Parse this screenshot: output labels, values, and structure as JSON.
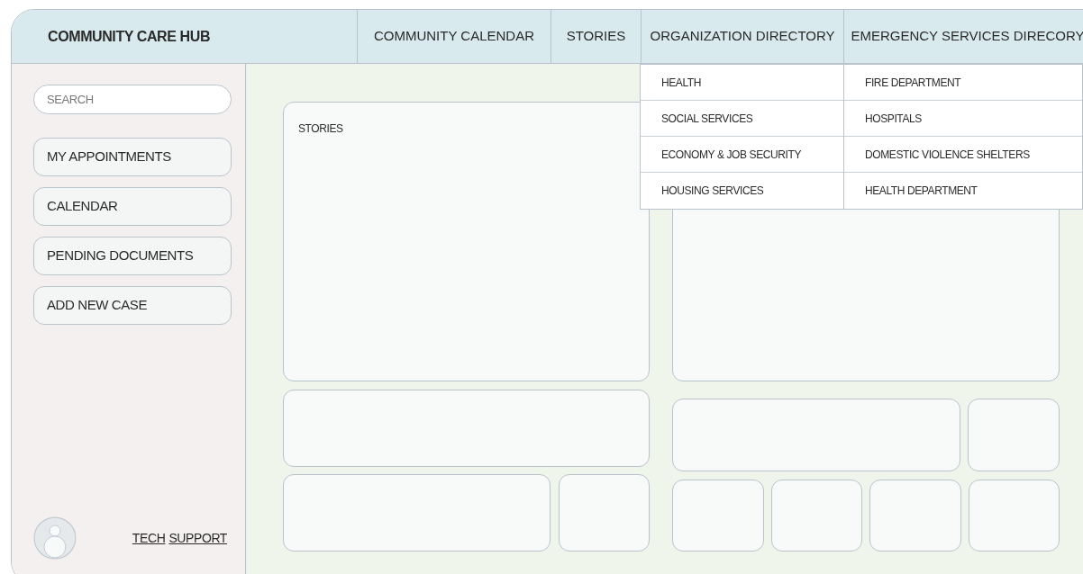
{
  "brand": "COMMUNITY CARE HUB",
  "nav": [
    {
      "label": "COMMUNITY CALENDAR"
    },
    {
      "label": "STORIES"
    },
    {
      "label": "ORGANIZATION DIRECTORY",
      "menu": [
        "HEALTH",
        "SOCIAL SERVICES",
        "ECONOMY & JOB SECURITY",
        "HOUSING SERVICES"
      ]
    },
    {
      "label": "EMERGENCY SERVICES DIRECORY",
      "menu": [
        "FIRE DEPARTMENT",
        "HOSPITALS",
        "DOMESTIC VIOLENCE SHELTERS",
        "HEALTH DEPARTMENT"
      ]
    }
  ],
  "sidebar": {
    "search": {
      "placeholder": "SEARCH"
    },
    "items": [
      "MY APPOINTMENTS",
      "CALENDAR",
      "PENDING DOCUMENTS",
      "ADD NEW CASE"
    ],
    "footer_links": [
      "TECH",
      "SUPPORT"
    ]
  },
  "main": {
    "stories_panel": {
      "title": "STORIES"
    }
  }
}
